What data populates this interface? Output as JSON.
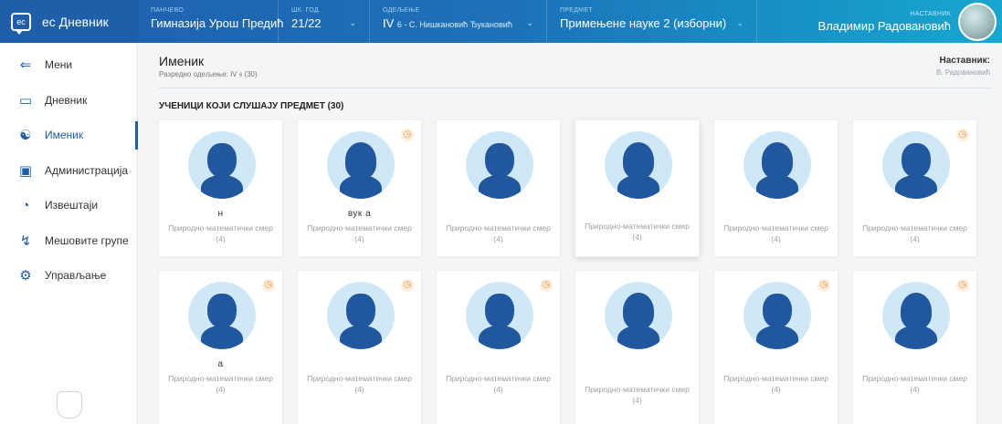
{
  "brand": {
    "name": "ес Дневник",
    "logo_text": "ес"
  },
  "topbar": {
    "school": {
      "label": "ПАНЧЕВО",
      "value": "Гимназија Урош Предић"
    },
    "year": {
      "label": "ШК. ГОД.",
      "value": "21/22"
    },
    "class": {
      "label": "ОДЕЉЕЊЕ",
      "value": "IV",
      "sub": "6",
      "homeroom": " - С. Нишкановић Ђукановић"
    },
    "subject": {
      "label": "ПРЕДМЕТ",
      "value": "Примењене науке 2 (изборни)"
    },
    "teacher": {
      "label": "НАСТАВНИК",
      "value": "Владимир Радовановић"
    }
  },
  "sidebar": {
    "items": [
      {
        "label": "Мени",
        "icon": "arrow-left-icon"
      },
      {
        "label": "Дневник",
        "icon": "book-icon"
      },
      {
        "label": "Именик",
        "icon": "users-icon"
      },
      {
        "label": "Администрација",
        "icon": "clipboard-icon"
      },
      {
        "label": "Извештаји",
        "icon": "pie-chart-icon"
      },
      {
        "label": "Мешовите групе",
        "icon": "group-icon"
      },
      {
        "label": "Управљање",
        "icon": "gear-icon"
      }
    ],
    "active_index": 2
  },
  "page": {
    "title": "Именик",
    "subtitle": "Разредно одељење: IV",
    "subtitle_sub": "6",
    "subtitle_count": " (30)",
    "teacher_label": "Наставник:",
    "teacher_name": "В. Радовановић",
    "section_title": "УЧЕНИЦИ КОЈИ СЛУШАЈУ ПРЕДМЕТ (30)"
  },
  "students": [
    {
      "name": "н",
      "smer": "Природно-математички смер (4)",
      "clock": false
    },
    {
      "name": "вук           а",
      "smer": "Природно-математички смер (4)",
      "clock": true
    },
    {
      "name": "",
      "smer": "Природно-математички смер (4)",
      "clock": false
    },
    {
      "name": "",
      "smer": "Природно-математички смер (4)",
      "clock": false
    },
    {
      "name": "",
      "smer": "Природно-математички смер (4)",
      "clock": false
    },
    {
      "name": "",
      "smer": "Природно-математички смер (4)",
      "clock": true
    },
    {
      "name": "а",
      "smer": "Природно-математички смер (4)",
      "clock": true
    },
    {
      "name": "",
      "smer": "Природно-математички смер (4)",
      "clock": true
    },
    {
      "name": "",
      "smer": "Природно-математички смер (4)",
      "clock": true
    },
    {
      "name": "",
      "smer": "Природно-математички смер (4)",
      "clock": false
    },
    {
      "name": "",
      "smer": "Природно-математички смер (4)",
      "clock": true
    },
    {
      "name": "",
      "smer": "Природно-математички смер (4)",
      "clock": true
    }
  ],
  "colors": {
    "brand": "#1f5ea8",
    "avatar_bg": "#cfe8f7",
    "avatar_fg": "#20579f",
    "clock": "#e39a4a"
  }
}
